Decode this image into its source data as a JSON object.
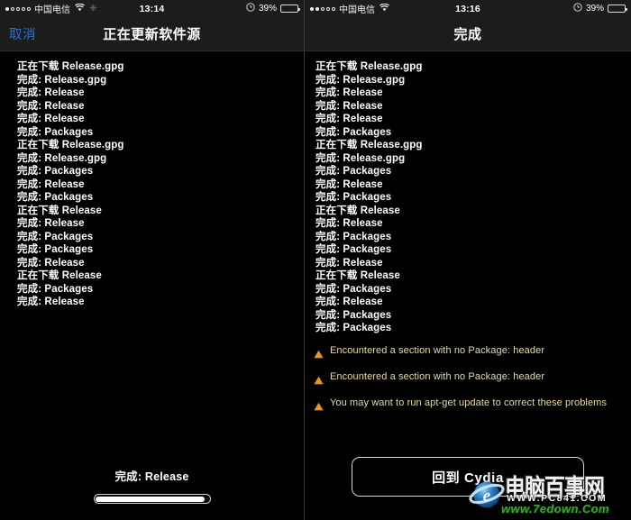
{
  "left": {
    "statusbar": {
      "carrier": "中国电信",
      "time": "13:14",
      "battery_pct": "39%",
      "signal_dots_filled": 1,
      "signal_dots_total": 5
    },
    "navbar": {
      "back_label": "取消",
      "title": "正在更新软件源"
    },
    "log_lines": [
      "正在下载 Release.gpg",
      "完成: Release.gpg",
      "完成: Release",
      "完成: Release",
      "完成: Release",
      "完成: Packages",
      "正在下载 Release.gpg",
      "完成: Release.gpg",
      "完成: Packages",
      "完成: Release",
      "完成: Packages",
      "正在下载 Release",
      "完成: Release",
      "完成: Packages",
      "完成: Packages",
      "完成: Release",
      "正在下载 Release",
      "完成: Packages",
      "完成: Release"
    ],
    "footer": {
      "status_text": "完成: Release",
      "progress_pct": 97
    }
  },
  "right": {
    "statusbar": {
      "carrier": "中国电信",
      "time": "13:16",
      "battery_pct": "39%",
      "signal_dots_filled": 2,
      "signal_dots_total": 5
    },
    "navbar": {
      "back_label": "",
      "title": "完成"
    },
    "log_lines": [
      "正在下载 Release.gpg",
      "完成: Release.gpg",
      "完成: Release",
      "完成: Release",
      "完成: Release",
      "完成: Packages",
      "正在下载 Release.gpg",
      "完成: Release.gpg",
      "完成: Packages",
      "完成: Release",
      "完成: Packages",
      "正在下载 Release",
      "完成: Release",
      "完成: Packages",
      "完成: Packages",
      "完成: Release",
      "正在下载 Release",
      "完成: Packages",
      "完成: Release",
      "完成: Packages",
      "完成: Packages"
    ],
    "warnings": [
      "Encountered a section with no Package: header",
      "Encountered a section with no Package: header",
      "You may want to run apt-get update to correct these problems"
    ],
    "footer": {
      "button_label": "回到 Cydia"
    }
  },
  "watermark": {
    "cn_text": "电脑百事网",
    "url_white": "WWW.PC841.COM",
    "url_green": "www.7edown.Com"
  },
  "colors": {
    "accent_blue": "#2f6fd0",
    "warning_text": "#e8dca6",
    "warning_icon": "#e8922a",
    "background": "#000000",
    "chrome": "#1c1c1c"
  }
}
